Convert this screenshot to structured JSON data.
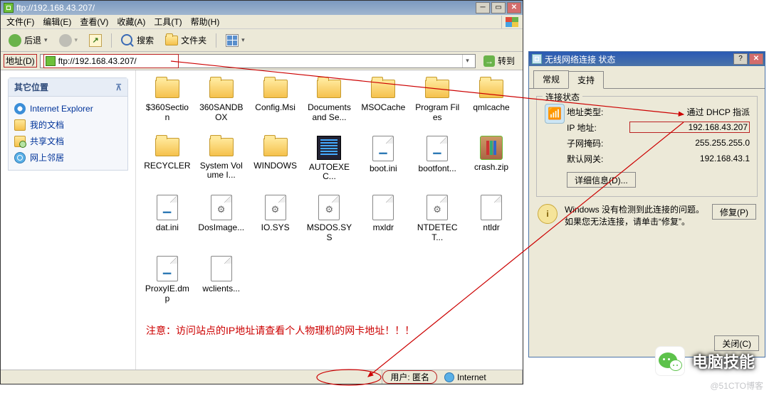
{
  "main": {
    "title": "ftp://192.168.43.207/",
    "menu": {
      "file": "文件(F)",
      "edit": "编辑(E)",
      "view": "查看(V)",
      "fav": "收藏(A)",
      "tools": "工具(T)",
      "help": "帮助(H)"
    },
    "toolbar": {
      "back": "后退",
      "search": "搜索",
      "folders": "文件夹"
    },
    "addr": {
      "label": "地址(D)",
      "value": "ftp://192.168.43.207/",
      "go": "转到"
    },
    "side": {
      "title": "其它位置",
      "links": [
        {
          "label": "Internet Explorer",
          "cls": "ie"
        },
        {
          "label": "我的文档",
          "cls": "doc"
        },
        {
          "label": "共享文档",
          "cls": "share"
        },
        {
          "label": "网上邻居",
          "cls": "net"
        }
      ]
    },
    "files": [
      {
        "name": "$360Section",
        "type": "folder"
      },
      {
        "name": "360SANDBOX",
        "type": "folder"
      },
      {
        "name": "Config.Msi",
        "type": "folder"
      },
      {
        "name": "Documents and Se...",
        "type": "folder"
      },
      {
        "name": "MSOCache",
        "type": "folder"
      },
      {
        "name": "Program Files",
        "type": "folder"
      },
      {
        "name": "qmlcache",
        "type": "folder"
      },
      {
        "name": "RECYCLER",
        "type": "folder"
      },
      {
        "name": "System Volume I...",
        "type": "folder"
      },
      {
        "name": "WINDOWS",
        "type": "folder"
      },
      {
        "name": "AUTOEXEC...",
        "type": "autoexec"
      },
      {
        "name": "boot.ini",
        "type": "docblue"
      },
      {
        "name": "bootfont...",
        "type": "docblue"
      },
      {
        "name": "crash.zip",
        "type": "zip"
      },
      {
        "name": "dat.ini",
        "type": "docblue"
      },
      {
        "name": "DosImage...",
        "type": "docgear"
      },
      {
        "name": "IO.SYS",
        "type": "docgear"
      },
      {
        "name": "MSDOS.SYS",
        "type": "docgear"
      },
      {
        "name": "mxldr",
        "type": "doc"
      },
      {
        "name": "NTDETECT...",
        "type": "docgear"
      },
      {
        "name": "ntldr",
        "type": "doc"
      },
      {
        "name": "ProxyIE.dmp",
        "type": "docblue"
      },
      {
        "name": "wclients...",
        "type": "doc"
      }
    ],
    "note": "注意：访问站点的IP地址请查看个人物理机的网卡地址！！！",
    "status": {
      "user": "用户: 匿名",
      "zone": "Internet"
    }
  },
  "dlg": {
    "title": "无线网络连接 状态",
    "tabs": {
      "general": "常规",
      "support": "支持"
    },
    "group": "连接状态",
    "rows": {
      "type_k": "地址类型:",
      "type_v": "通过 DHCP 指派",
      "ip_k": "IP 地址:",
      "ip_v": "192.168.43.207",
      "mask_k": "子网掩码:",
      "mask_v": "255.255.255.0",
      "gw_k": "默认网关:",
      "gw_v": "192.168.43.1"
    },
    "details": "详细信息(D)...",
    "help": "Windows 没有检测到此连接的问题。如果您无法连接，请单击“修复”。",
    "repair": "修复(P)",
    "close": "关闭(C)"
  },
  "wechat": {
    "name": "电脑技能"
  },
  "watermark": "@51CTO博客"
}
